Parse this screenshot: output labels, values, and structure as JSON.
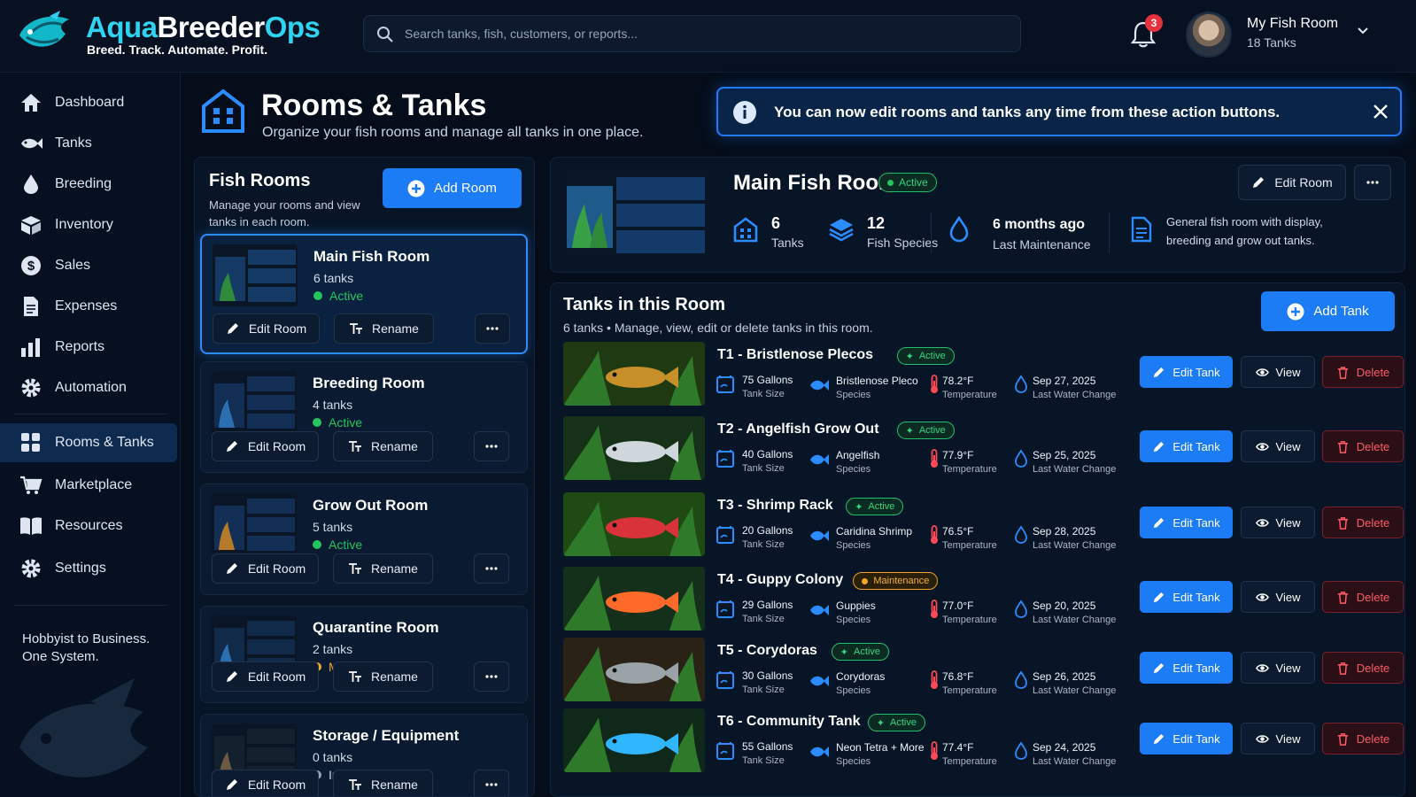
{
  "app": {
    "name_part1": "Aqua",
    "name_part2": "Breeder",
    "name_part3": "Ops",
    "tagline": "Breed. Track. Automate. Profit."
  },
  "search": {
    "placeholder": "Search tanks, fish, customers, or reports..."
  },
  "notifications": {
    "count": "3"
  },
  "user": {
    "name": "My Fish Room",
    "sub": "18 Tanks"
  },
  "sidebar": {
    "items": [
      {
        "label": "Dashboard",
        "icon": "home-icon"
      },
      {
        "label": "Tanks",
        "icon": "fish-icon"
      },
      {
        "label": "Breeding",
        "icon": "drop-icon"
      },
      {
        "label": "Inventory",
        "icon": "box-icon"
      },
      {
        "label": "Sales",
        "icon": "dollar-icon"
      },
      {
        "label": "Expenses",
        "icon": "document-icon"
      },
      {
        "label": "Reports",
        "icon": "bar-chart-icon"
      },
      {
        "label": "Automation",
        "icon": "gear-icon"
      },
      {
        "label": "Rooms & Tanks",
        "icon": "grid-icon",
        "active": true
      },
      {
        "label": "Marketplace",
        "icon": "cart-icon"
      },
      {
        "label": "Resources",
        "icon": "book-icon"
      },
      {
        "label": "Settings",
        "icon": "settings-icon"
      }
    ],
    "footer_line1": "Hobbyist to Business.",
    "footer_line2": "One System."
  },
  "page": {
    "title": "Rooms & Tanks",
    "subtitle": "Organize your fish rooms and manage all tanks in one place."
  },
  "banner": {
    "text": "You can now edit rooms and tanks any time from these action buttons."
  },
  "rooms_panel": {
    "title": "Fish Rooms",
    "subtitle": "Manage your rooms and view tanks in each room.",
    "add_label": "Add Room",
    "edit_label": "Edit Room",
    "rename_label": "Rename",
    "rooms": [
      {
        "name": "Main Fish Room",
        "count": "6 tanks",
        "status": "Active",
        "status_color": "#22c55e"
      },
      {
        "name": "Breeding Room",
        "count": "4 tanks",
        "status": "Active",
        "status_color": "#22c55e"
      },
      {
        "name": "Grow Out Room",
        "count": "5 tanks",
        "status": "Active",
        "status_color": "#22c55e"
      },
      {
        "name": "Quarantine Room",
        "count": "2 tanks",
        "status": "Maintenance",
        "status_color": "#f4a629"
      },
      {
        "name": "Storage / Equipment",
        "count": "0 tanks",
        "status": "Inactive",
        "status_color": "#9aa5b4"
      }
    ]
  },
  "main_room": {
    "title": "Main Fish Room",
    "status": "Active",
    "edit_label": "Edit Room",
    "tanks_n": "6",
    "tanks_l": "Tanks",
    "species_n": "12",
    "species_l": "Fish Species",
    "maint_n": "6 months ago",
    "maint_l": "Last Maintenance",
    "description": "General fish room with display, breeding and grow out tanks."
  },
  "tanks_panel": {
    "title": "Tanks in this Room",
    "subtitle": "6 tanks • Manage, view, edit or delete tanks in this room.",
    "add_label": "Add Tank",
    "edit_label": "Edit Tank",
    "view_label": "View",
    "delete_label": "Delete",
    "size_label": "Tank Size",
    "species_label": "Species",
    "temp_label": "Temperature",
    "water_label": "Last Water Change",
    "tanks": [
      {
        "name": "T1 - Bristlenose Plecos",
        "status": "Active",
        "size": "75 Gallons",
        "species": "Bristlenose Pleco",
        "temp": "78.2°F",
        "water": "Sep 27, 2025"
      },
      {
        "name": "T2 - Angelfish Grow Out",
        "status": "Active",
        "size": "40 Gallons",
        "species": "Angelfish",
        "temp": "77.9°F",
        "water": "Sep 25, 2025"
      },
      {
        "name": "T3 - Shrimp Rack",
        "status": "Active",
        "size": "20 Gallons",
        "species": "Caridina Shrimp",
        "temp": "76.5°F",
        "water": "Sep 28, 2025"
      },
      {
        "name": "T4 - Guppy Colony",
        "status": "Maintenance",
        "size": "29 Gallons",
        "species": "Guppies",
        "temp": "77.0°F",
        "water": "Sep 20, 2025"
      },
      {
        "name": "T5 - Corydoras",
        "status": "Active",
        "size": "30 Gallons",
        "species": "Corydoras",
        "temp": "76.8°F",
        "water": "Sep 26, 2025"
      },
      {
        "name": "T6 - Community Tank",
        "status": "Active",
        "size": "55 Gallons",
        "species": "Neon Tetra + More",
        "temp": "77.4°F",
        "water": "Sep 24, 2025"
      }
    ]
  },
  "colors": {
    "accent": "#1c7cf6",
    "active": "#22c55e",
    "maintenance": "#f4a629",
    "danger": "#ff5a64"
  }
}
